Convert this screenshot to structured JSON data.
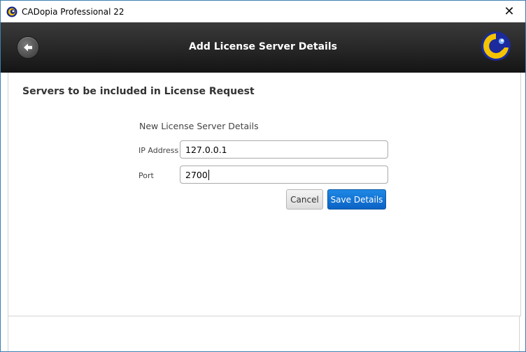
{
  "window": {
    "title": "CADopia Professional 22",
    "close_glyph": "✕"
  },
  "header": {
    "title": "Add License Server Details",
    "back_icon": "back-arrow-icon",
    "logo_icon": "cadopia-logo-icon"
  },
  "panel": {
    "section_title": "Servers to be included in License Request",
    "form": {
      "title": "New License Server Details",
      "ip_label": "IP Address",
      "ip_value": "127.0.0.1",
      "port_label": "Port",
      "port_value": "2700",
      "cancel_label": "Cancel",
      "save_label": "Save Details"
    }
  },
  "colors": {
    "accent": "#0b62c4",
    "header_bg": "#262626",
    "window_border": "#3c7fb1"
  }
}
